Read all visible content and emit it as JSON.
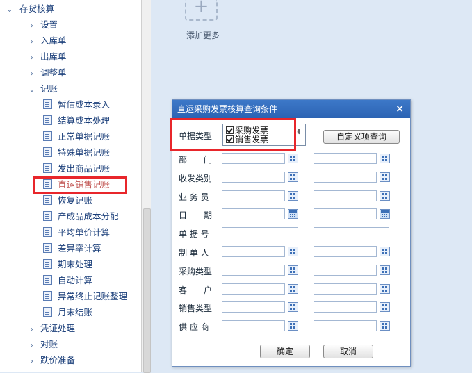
{
  "tree": {
    "root": "存货核算",
    "items": [
      {
        "label": "设置",
        "type": "group"
      },
      {
        "label": "入库单",
        "type": "group"
      },
      {
        "label": "出库单",
        "type": "group"
      },
      {
        "label": "调整单",
        "type": "group"
      },
      {
        "label": "记账",
        "type": "group-open"
      },
      {
        "label": "暂估成本录入",
        "type": "leaf"
      },
      {
        "label": "结算成本处理",
        "type": "leaf"
      },
      {
        "label": "正常单据记账",
        "type": "leaf"
      },
      {
        "label": "特殊单据记账",
        "type": "leaf"
      },
      {
        "label": "发出商品记账",
        "type": "leaf"
      },
      {
        "label": "直运销售记账",
        "type": "leaf",
        "active": true
      },
      {
        "label": "恢复记账",
        "type": "leaf"
      },
      {
        "label": "产成品成本分配",
        "type": "leaf"
      },
      {
        "label": "平均单价计算",
        "type": "leaf"
      },
      {
        "label": "差异率计算",
        "type": "leaf"
      },
      {
        "label": "期末处理",
        "type": "leaf"
      },
      {
        "label": "自动计算",
        "type": "leaf"
      },
      {
        "label": "异常终止记账整理",
        "type": "leaf"
      },
      {
        "label": "月末结账",
        "type": "leaf"
      },
      {
        "label": "凭证处理",
        "type": "group"
      },
      {
        "label": "对账",
        "type": "group"
      },
      {
        "label": "跌价准备",
        "type": "group"
      }
    ]
  },
  "workspace": {
    "add_more": "添加更多",
    "add_icon": "+"
  },
  "dialog": {
    "title": "直运采购发票核算查询条件",
    "close": "×",
    "doc_type_label": "单据类型",
    "doc_types": [
      "采购发票",
      "销售发票"
    ],
    "custom_query": "自定义项查询",
    "fields": [
      {
        "label": "部　　门",
        "picker": "lookup"
      },
      {
        "label": "收发类别",
        "picker": "lookup"
      },
      {
        "label": "业 务 员",
        "picker": "lookup"
      },
      {
        "label": "日　　期",
        "picker": "calendar"
      },
      {
        "label": "单 据 号",
        "picker": "none"
      },
      {
        "label": "制 单 人",
        "picker": "lookup"
      },
      {
        "label": "采购类型",
        "picker": "lookup"
      },
      {
        "label": "客　　户",
        "picker": "lookup"
      },
      {
        "label": "销售类型",
        "picker": "lookup"
      },
      {
        "label": "供 应 商",
        "picker": "lookup"
      }
    ],
    "ok": "确定",
    "cancel": "取消"
  },
  "colors": {
    "title_bar": "#2b63b3",
    "highlight": "#e8262b",
    "active_item": "#c0504d",
    "workspace_bg": "#dde8f5"
  }
}
